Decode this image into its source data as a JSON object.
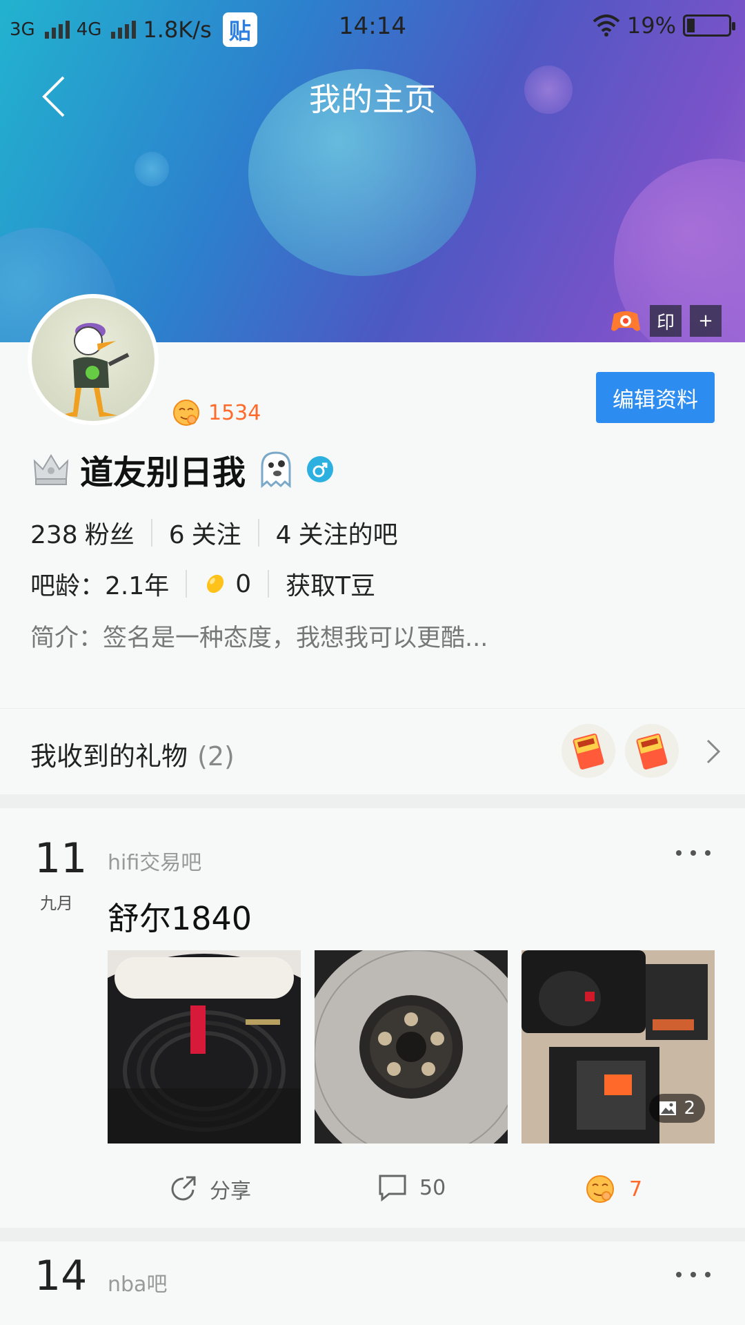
{
  "status_bar": {
    "net1": "3G",
    "net2": "4G",
    "speed": "1.8K/s",
    "app_badge": "贴",
    "time": "14:14",
    "battery": "19%",
    "battery_level": 0.19
  },
  "header": {
    "title": "我的主页",
    "tool_seal": "印",
    "tool_add": "+"
  },
  "profile": {
    "level_value": "1534",
    "edit_button": "编辑资料",
    "username": "道友别日我",
    "stats": {
      "fans_count": "238",
      "fans_label": "粉丝",
      "following_count": "6",
      "following_label": "关注",
      "forums_count": "4",
      "forums_label": "关注的吧"
    },
    "info": {
      "age_label": "吧龄：2.1年",
      "tdou_count": "0",
      "get_tdou": "获取T豆"
    },
    "bio": "简介：签名是一种态度，我想我可以更酷..."
  },
  "gifts": {
    "title": "我收到的礼物",
    "count": "(2)"
  },
  "posts": [
    {
      "day": "11",
      "month": "九月",
      "forum": "hifi交易吧",
      "title": "舒尔1840",
      "image_count": "2",
      "share_label": "分享",
      "comments": "50",
      "likes": "7"
    },
    {
      "day": "14",
      "forum": "nba吧"
    }
  ],
  "colors": {
    "accent": "#2d8cf0",
    "level": "#ff6a2a"
  }
}
